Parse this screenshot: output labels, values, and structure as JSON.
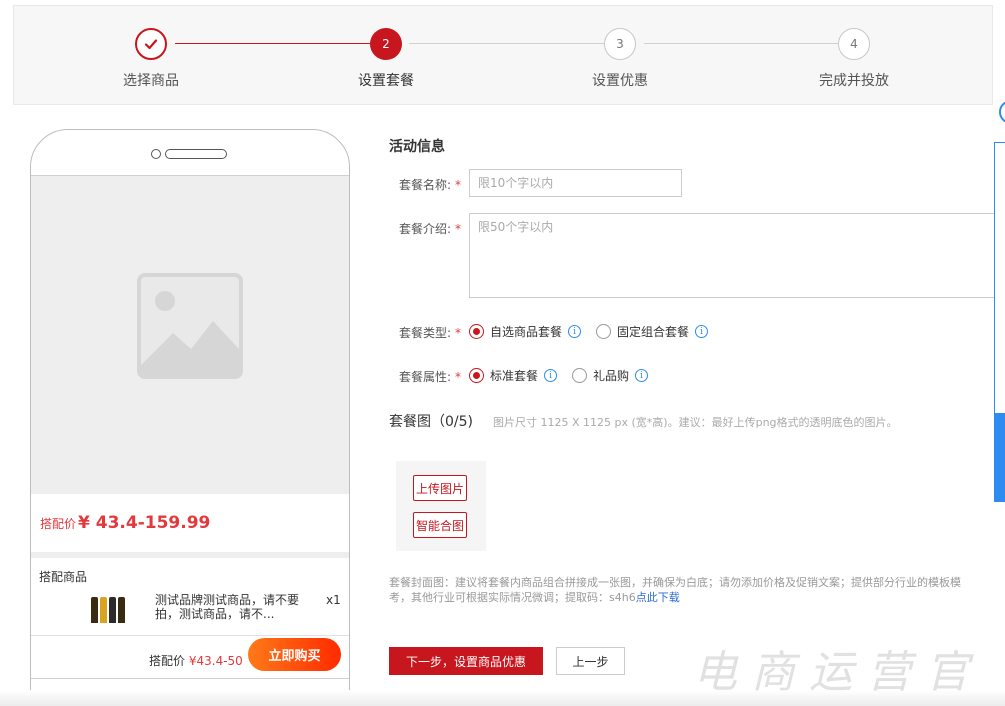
{
  "stepper": {
    "steps": [
      {
        "label": "选择商品",
        "number": "✓",
        "state": "done"
      },
      {
        "label": "设置套餐",
        "number": "2",
        "state": "active"
      },
      {
        "label": "设置优惠",
        "number": "3",
        "state": "todo"
      },
      {
        "label": "完成并投放",
        "number": "4",
        "state": "todo"
      }
    ]
  },
  "preview": {
    "price_label": "搭配价",
    "price_value": "¥ 43.4-159.99",
    "combo_title": "搭配商品",
    "combo_item_name": "测试品牌测试商品，请不要拍，测试商品，请不...",
    "combo_item_qty": "x1",
    "bottom_price_label": "搭配价",
    "bottom_price_value": "¥43.4-50",
    "buy_label": "立即购买"
  },
  "form": {
    "section_title": "活动信息",
    "name_label": "套餐名称:",
    "name_placeholder": "限10个字以内",
    "intro_label": "套餐介绍:",
    "intro_placeholder": "限50个字以内",
    "required_mark": "*",
    "type_label": "套餐类型:",
    "type_options": [
      "自选商品套餐",
      "固定组合套餐"
    ],
    "type_selected": "自选商品套餐",
    "attr_label": "套餐属性:",
    "attr_options": [
      "标准套餐",
      "礼品购"
    ],
    "attr_selected": "标准套餐",
    "image_title": "套餐图（0/5)",
    "image_hint": "图片尺寸 1125 X 1125 px (宽*高)。建议：最好上传png格式的透明底色的图片。",
    "upload_label": "上传图片",
    "smart_merge_label": "智能合图",
    "cover_note_line1": "套餐封面图：建议将套餐内商品组合拼接成一张图，并确保为白底；请勿添加价格及促销文案；提供部分行业的模板模",
    "cover_note_line2_prefix": "考，其他行业可根据实际情况微调；提取码：s4h6",
    "cover_note_link": "点此下载",
    "next_label": "下一步，设置商品优惠",
    "prev_label": "上一步"
  },
  "watermark": "电商运营官",
  "colors": {
    "primary": "#c8161e",
    "price": "#e4393c",
    "info": "#2d8cf0"
  }
}
